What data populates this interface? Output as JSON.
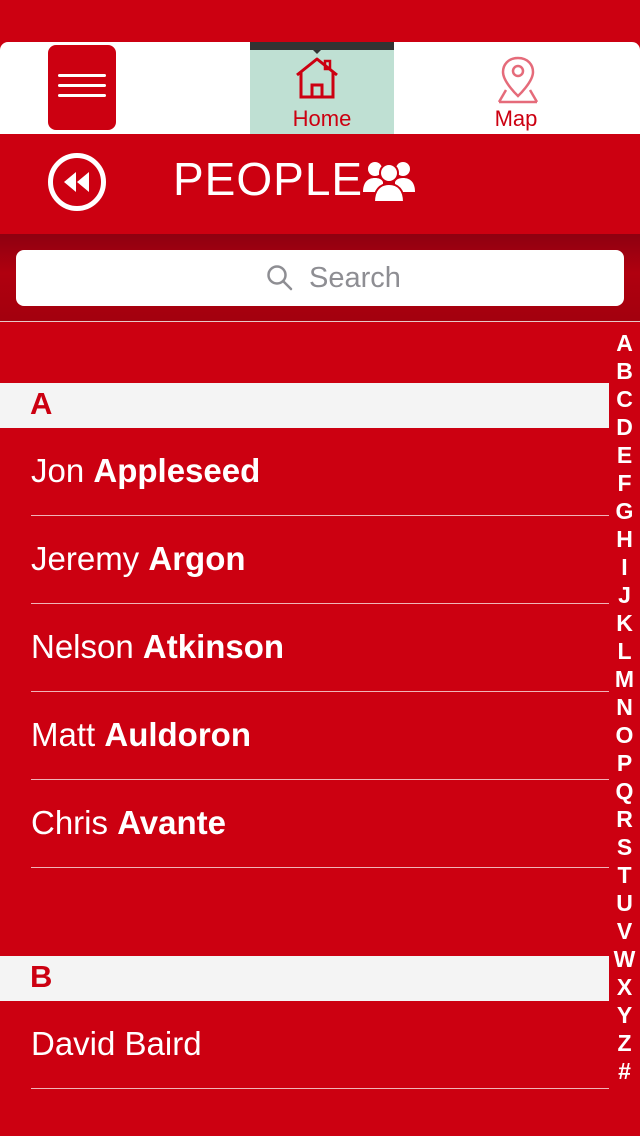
{
  "topbar": {
    "menu_icon": "hamburger-icon",
    "tabs": [
      {
        "label": "Home",
        "icon": "house-icon",
        "active": true
      },
      {
        "label": "Map",
        "icon": "map-pin-icon",
        "active": false
      }
    ]
  },
  "header": {
    "back_icon": "rewind-back-icon",
    "title": "PEOPLE",
    "title_icon": "people-group-icon"
  },
  "search": {
    "placeholder": "Search",
    "icon": "search-icon"
  },
  "sections": [
    {
      "letter": "A",
      "people": [
        {
          "first": "Jon ",
          "last": "Appleseed"
        },
        {
          "first": "Jeremy ",
          "last": "Argon"
        },
        {
          "first": "Nelson ",
          "last": "Atkinson"
        },
        {
          "first": "Matt ",
          "last": "Auldoron"
        },
        {
          "first": "Chris ",
          "last": "Avante"
        }
      ]
    },
    {
      "letter": "B",
      "people": [
        {
          "first": "David Baird",
          "last": ""
        }
      ]
    }
  ],
  "index_letters": [
    "A",
    "B",
    "C",
    "D",
    "E",
    "F",
    "G",
    "H",
    "I",
    "J",
    "K",
    "L",
    "M",
    "N",
    "O",
    "P",
    "Q",
    "R",
    "S",
    "T",
    "U",
    "V",
    "W",
    "X",
    "Y",
    "Z",
    "#"
  ],
  "colors": {
    "accent": "#cc0011",
    "active_tab": "#bfe0d3",
    "section_header_bg": "#f4f4f4"
  }
}
